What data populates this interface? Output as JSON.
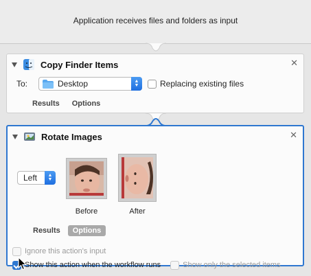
{
  "input_header": "Application receives files and folders as input",
  "copy_action": {
    "title": "Copy Finder Items",
    "to_label": "To:",
    "destination": "Desktop",
    "replacing_label": "Replacing existing files",
    "replacing_checked": false,
    "tabs": [
      {
        "label": "Results",
        "active": false
      },
      {
        "label": "Options",
        "active": false
      }
    ]
  },
  "rotate_action": {
    "title": "Rotate Images",
    "direction": "Left",
    "before_label": "Before",
    "after_label": "After",
    "tabs": [
      {
        "label": "Results",
        "active": false
      },
      {
        "label": "Options",
        "active": true
      }
    ],
    "options": {
      "ignore_input_label": "Ignore this action's input",
      "ignore_input_checked": false,
      "show_action_label": "Show this action when the workflow runs",
      "show_action_checked": true,
      "show_selected_label": "Show only the selected items",
      "show_selected_checked": false
    }
  },
  "colors": {
    "selection_accent": "#2e77d0",
    "background": "#e6e6e6"
  },
  "icons": {
    "close": "close-icon",
    "disclosure": "disclosure-triangle-icon",
    "copy_action": "finder-icon",
    "rotate_action": "preview-icon",
    "folder": "folder-icon"
  }
}
